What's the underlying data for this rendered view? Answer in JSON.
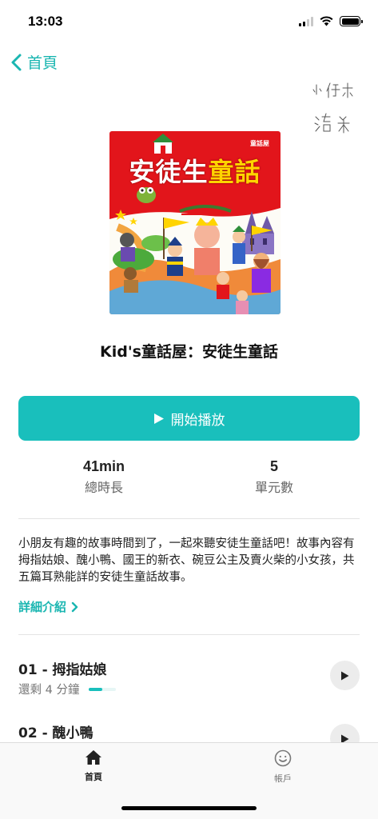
{
  "status": {
    "time": "13:03"
  },
  "nav": {
    "back_label": "首頁"
  },
  "handwriting": {
    "line1": "小 傑 米",
    "line2": "洛 米"
  },
  "book": {
    "cover_title_a": "安徒生",
    "cover_title_b": "童話",
    "cover_brand": "童話屋",
    "title": "Kid's童話屋：安徒生童話"
  },
  "actions": {
    "play_label": "開始播放"
  },
  "stats": {
    "duration_value": "41min",
    "duration_label": "總時長",
    "units_value": "5",
    "units_label": "單元數"
  },
  "description": {
    "text": "小朋友有趣的故事時間到了，一起來聽安徒生童話吧！故事內容有拇指姑娘、醜小鴨、國王的新衣、碗豆公主及賣火柴的小女孩，共五篇耳熟能詳的安徒生童話故事。",
    "more_label": "詳細介紹"
  },
  "episodes": [
    {
      "title": "01 - 拇指姑娘",
      "remaining": "還剩 4 分鐘",
      "progress": 0.5
    },
    {
      "title": "02 - 醜小鴨"
    }
  ],
  "tabbar": {
    "home_label": "首頁",
    "account_label": "帳戶"
  },
  "colors": {
    "accent": "#19bfbc",
    "cover_red": "#e2151b"
  },
  "icons": [
    "back-chevron-icon",
    "play-icon",
    "chevron-right-icon",
    "home-icon",
    "smiley-icon"
  ]
}
